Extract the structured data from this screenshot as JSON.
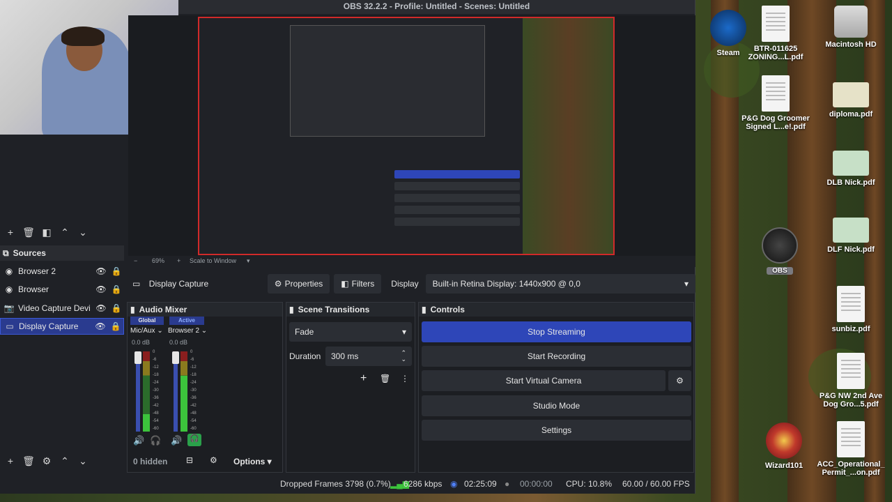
{
  "window": {
    "title": "OBS 32.2.2 - Profile: Untitled - Scenes: Untitled"
  },
  "preview": {
    "zoom": "69%",
    "scale_mode": "Scale to Window"
  },
  "sources": {
    "header": "Sources",
    "items": [
      {
        "label": "Browser 2",
        "icon": "globe-icon"
      },
      {
        "label": "Browser",
        "icon": "globe-icon"
      },
      {
        "label": "Video Capture Devi",
        "icon": "camera-icon"
      },
      {
        "label": "Display Capture",
        "icon": "monitor-icon",
        "selected": true
      }
    ]
  },
  "context": {
    "source_name": "Display Capture",
    "properties_label": "Properties",
    "filters_label": "Filters",
    "display_label": "Display",
    "display_value": "Built-in Retina Display: 1440x900 @ 0,0"
  },
  "mixer": {
    "title": "Audio Mixer",
    "tab_global": "Global",
    "tab_active": "Active",
    "channels": [
      {
        "name": "Mic/Aux",
        "db": "0.0 dB"
      },
      {
        "name": "Browser 2",
        "db": "0.0 dB"
      }
    ],
    "ticks": [
      "0",
      "-6",
      "-12",
      "-18",
      "-24",
      "-30",
      "-36",
      "-42",
      "-48",
      "-54",
      "-60"
    ],
    "hidden_label": "0 hidden",
    "options_label": "Options"
  },
  "transitions": {
    "title": "Scene Transitions",
    "selected": "Fade",
    "duration_label": "Duration",
    "duration_value": "300 ms"
  },
  "controls": {
    "title": "Controls",
    "stop_streaming": "Stop Streaming",
    "start_recording": "Start Recording",
    "start_virtual_camera": "Start Virtual Camera",
    "studio_mode": "Studio Mode",
    "settings": "Settings"
  },
  "status": {
    "dropped_frames": "Dropped Frames 3798 (0.7%)",
    "bitrate": "6286 kbps",
    "stream_time": "02:25:09",
    "record_time": "00:00:00",
    "cpu": "CPU: 10.8%",
    "fps": "60.00 / 60.00 FPS"
  },
  "desktop": {
    "icons": [
      {
        "label": "Steam"
      },
      {
        "label": "BTR-011625 ZONING...L.pdf"
      },
      {
        "label": "Macintosh HD"
      },
      {
        "label": "P&G Dog Groomer Signed L...e!.pdf"
      },
      {
        "label": "diploma.pdf"
      },
      {
        "label": "DLB Nick.pdf"
      },
      {
        "label": "OBS"
      },
      {
        "label": "DLF Nick.pdf"
      },
      {
        "label": "sunbiz.pdf"
      },
      {
        "label": "P&G NW 2nd Ave Dog Gro...5.pdf"
      },
      {
        "label": "Wizard101"
      },
      {
        "label": "ACC_Operational_ Permit_...on.pdf"
      }
    ]
  },
  "colors": {
    "accent": "#2e46b8",
    "selected_row": "#2a3b8f",
    "panel_bg": "#1c1e22",
    "stream_red": "#d12a2a"
  }
}
